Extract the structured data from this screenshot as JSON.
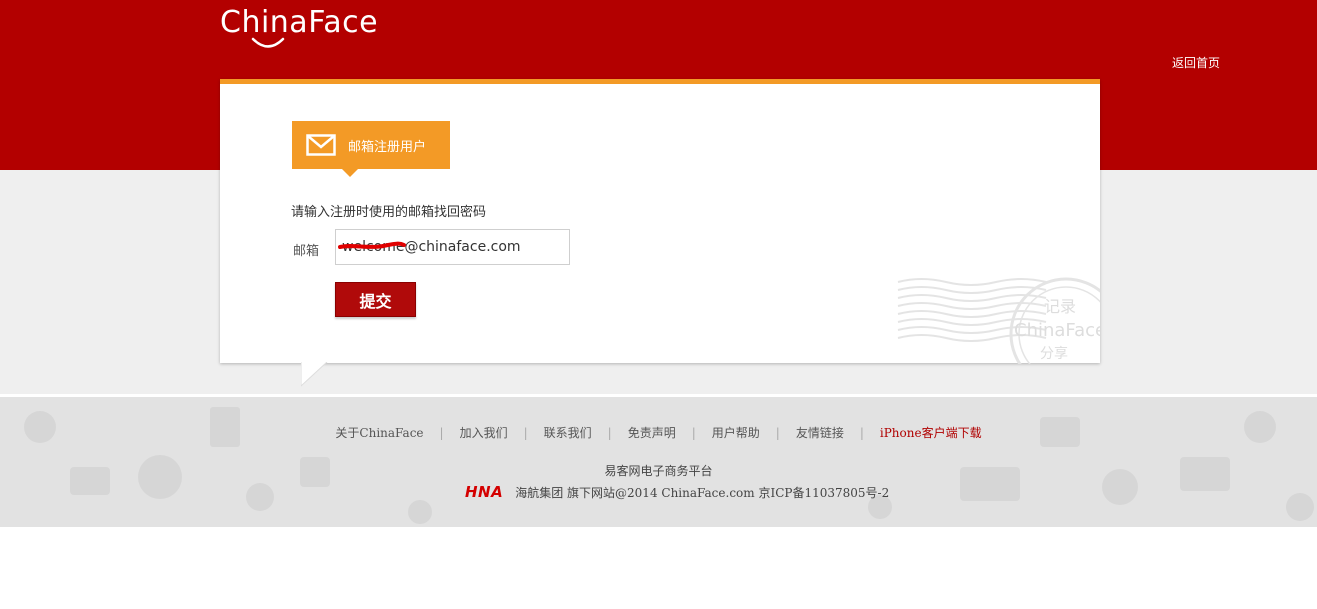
{
  "header": {
    "logo_text": "ChinaFace",
    "home_link": "返回首页"
  },
  "tab": {
    "label": "邮箱注册用户",
    "icon": "envelope-icon"
  },
  "form": {
    "instruction": "请输入注册时使用的邮箱找回密码",
    "email_label": "邮箱",
    "email_value": "welcome@chinaface.com",
    "submit_label": "提交"
  },
  "stamp": {
    "line1": "记录",
    "line2": "ChinaFace",
    "line3": "分享"
  },
  "footer": {
    "links": [
      "关于ChinaFace",
      "加入我们",
      "联系我们",
      "免责声明",
      "用户帮助",
      "友情链接",
      "iPhone客户端下载"
    ],
    "separator": "|",
    "platform": "易客网电子商务平台",
    "hna_logo": "HNA",
    "copyright": "海航集团 旗下网站@2014 ChinaFace.com 京ICP备11037805号-2"
  },
  "colors": {
    "brand_red": "#b30000",
    "accent_orange": "#f39a26",
    "submit_red": "#b00a0a"
  }
}
